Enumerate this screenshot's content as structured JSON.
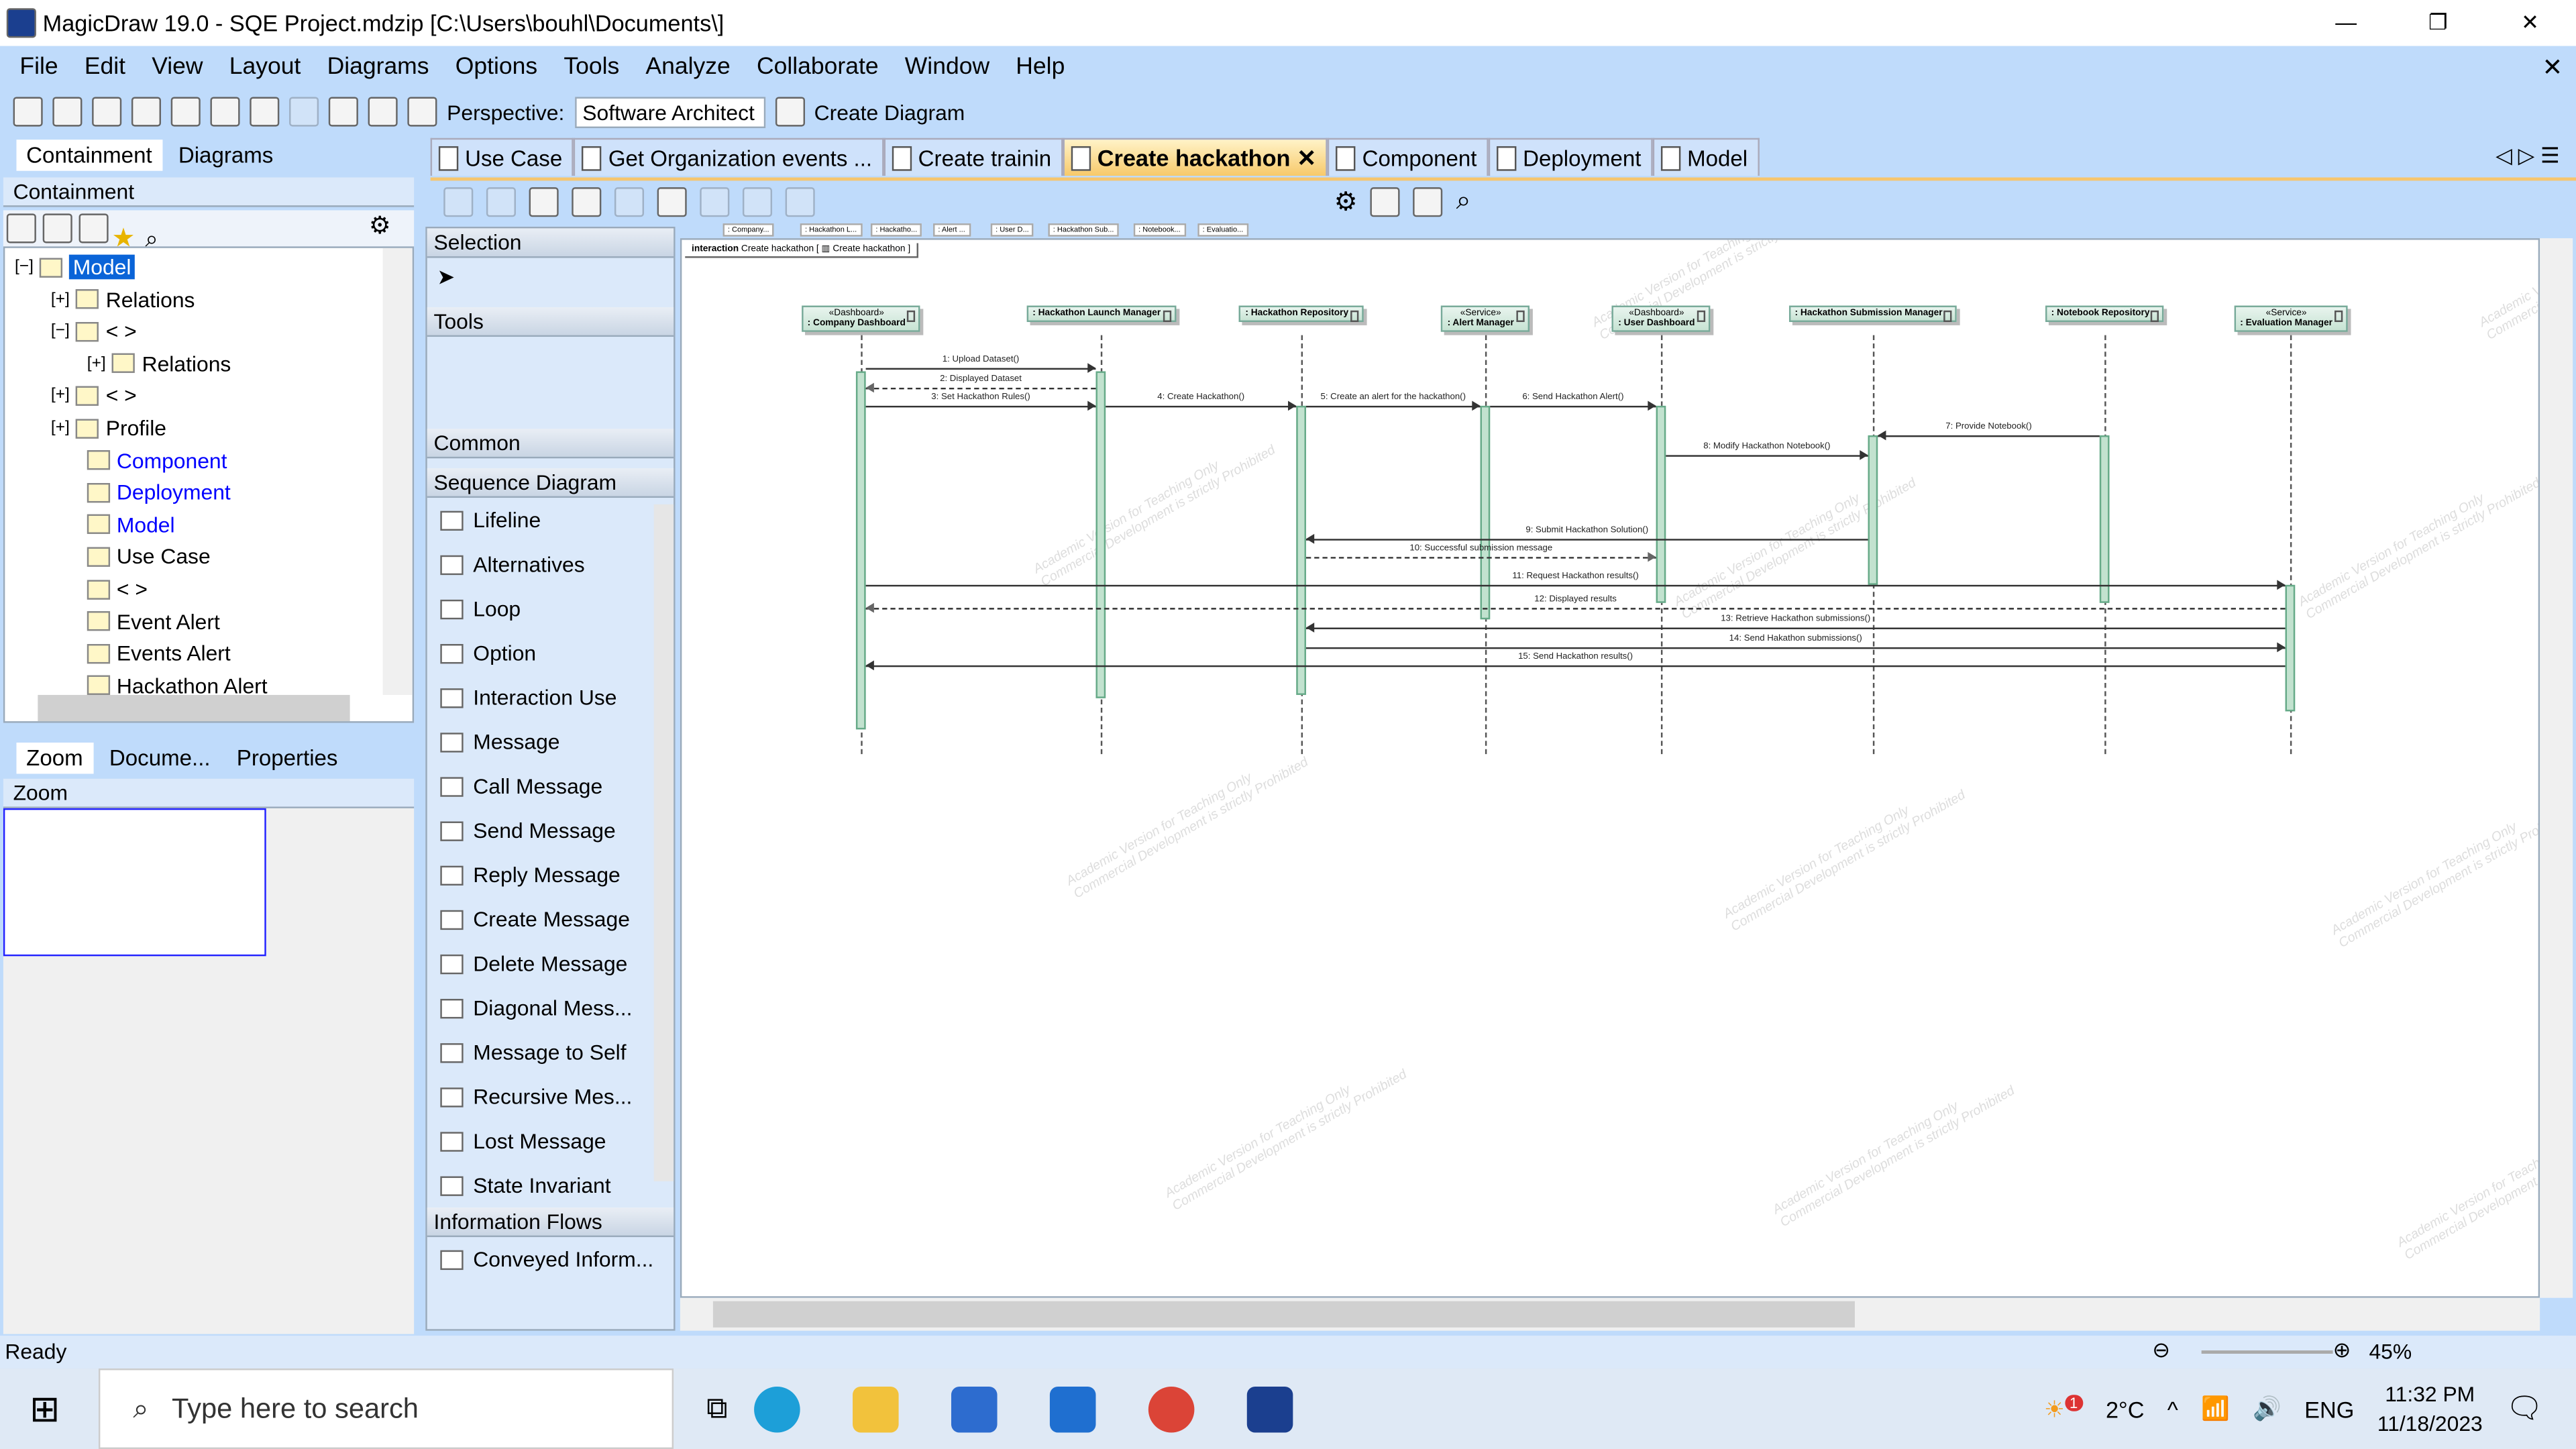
{
  "window": {
    "title": "MagicDraw 19.0 - SQE Project.mdzip [C:\\Users\\bouhl\\Documents\\]",
    "minimize": "—",
    "restore": "❐",
    "close": "✕"
  },
  "menu": [
    "File",
    "Edit",
    "View",
    "Layout",
    "Diagrams",
    "Options",
    "Tools",
    "Analyze",
    "Collaborate",
    "Window",
    "Help"
  ],
  "toolbar": {
    "perspective_label": "Perspective:",
    "perspective_value": "Software Architect",
    "create_diagram": "Create Diagram"
  },
  "left_panel": {
    "tabs": [
      "Containment",
      "Diagrams"
    ],
    "header": "Containment",
    "tree": [
      {
        "label": "Model",
        "level": 0,
        "expander": "−",
        "selected": true
      },
      {
        "label": "Relations",
        "level": 1,
        "expander": "+"
      },
      {
        "label": "< >",
        "level": 1,
        "expander": "−"
      },
      {
        "label": "Relations",
        "level": 2,
        "expander": "+"
      },
      {
        "label": "< >",
        "level": 1,
        "expander": "+"
      },
      {
        "label": "Profile",
        "level": 1,
        "expander": "+"
      },
      {
        "label": "Component",
        "level": 1,
        "link": true
      },
      {
        "label": "Deployment",
        "level": 1,
        "link": true
      },
      {
        "label": "Model",
        "level": 1,
        "link": true
      },
      {
        "label": "Use Case",
        "level": 1
      },
      {
        "label": "< >",
        "level": 1
      },
      {
        "label": "Event Alert",
        "level": 1
      },
      {
        "label": "Events Alert",
        "level": 1
      },
      {
        "label": "Hackathon Alert",
        "level": 1
      }
    ],
    "bottom_tabs": [
      "Zoom",
      "Docume...",
      "Properties"
    ],
    "zoom_header": "Zoom"
  },
  "palette": {
    "selection": "Selection",
    "tools": "Tools",
    "common": "Common",
    "sequence": "Sequence Diagram",
    "items": [
      "Lifeline",
      "Alternatives",
      "Loop",
      "Option",
      "Interaction Use",
      "Message",
      "Call Message",
      "Send Message",
      "Reply Message",
      "Create Message",
      "Delete Message",
      "Diagonal Mess...",
      "Message to Self",
      "Recursive Mes...",
      "Lost Message",
      "State Invariant"
    ],
    "information_flows": "Information Flows",
    "conveyed": "Conveyed Inform..."
  },
  "tabs": [
    {
      "label": "Use Case"
    },
    {
      "label": "Get Organization events ..."
    },
    {
      "label": "Create trainin"
    },
    {
      "label": "Create hackathon",
      "active": true,
      "close": "✕"
    },
    {
      "label": "Component"
    },
    {
      "label": "Deployment"
    },
    {
      "label": "Model"
    }
  ],
  "diagram": {
    "frame_keyword": "interaction",
    "frame_name": "Create hackathon",
    "frame_ref": "Create hackathon",
    "mini_headers": [
      ": Company...",
      ": Hackathon L...",
      ": Hackatho...",
      ": Alert ...",
      ": User D...",
      ": Hackathon Sub...",
      ": Notebook...",
      ": Evaluatio..."
    ],
    "lifelines": [
      {
        "stereotype": "«Dashboard»",
        "name": ": Company Dashboard"
      },
      {
        "stereotype": "",
        "name": ": Hackathon Launch Manager"
      },
      {
        "stereotype": "",
        "name": ": Hackathon Repository"
      },
      {
        "stereotype": "«Service»",
        "name": ": Alert Manager"
      },
      {
        "stereotype": "«Dashboard»",
        "name": ": User Dashboard"
      },
      {
        "stereotype": "",
        "name": ": Hackathon Submission Manager"
      },
      {
        "stereotype": "",
        "name": ": Notebook Repository"
      },
      {
        "stereotype": "«Service»",
        "name": ": Evaluation Manager"
      }
    ],
    "messages": [
      {
        "label": "1: Upload Dataset()",
        "from": 0,
        "to": 1,
        "kind": "call"
      },
      {
        "label": "2: Displayed Dataset",
        "from": 1,
        "to": 0,
        "kind": "reply"
      },
      {
        "label": "3: Set Hackathon Rules()",
        "from": 0,
        "to": 1,
        "kind": "call"
      },
      {
        "label": "4: Create Hackathon()",
        "from": 1,
        "to": 2,
        "kind": "call"
      },
      {
        "label": "5: Create an alert for the hackathon()",
        "from": 2,
        "to": 3,
        "kind": "call"
      },
      {
        "label": "6: Send Hackathon Alert()",
        "from": 3,
        "to": 4,
        "kind": "call"
      },
      {
        "label": "7: Provide Notebook()",
        "from": 6,
        "to": 5,
        "kind": "call"
      },
      {
        "label": "8: Modify Hackathon Notebook()",
        "from": 4,
        "to": 5,
        "kind": "call"
      },
      {
        "label": "9: Submit Hackathon Solution()",
        "from": 5,
        "to": 2,
        "kind": "call"
      },
      {
        "label": "10: Successful submission message",
        "from": 2,
        "to": 4,
        "kind": "reply"
      },
      {
        "label": "11: Request Hackathon results()",
        "from": 0,
        "to": 7,
        "kind": "call"
      },
      {
        "label": "12: Displayed results",
        "from": 7,
        "to": 0,
        "kind": "reply"
      },
      {
        "label": "13: Retrieve Hackathon submissions()",
        "from": 7,
        "to": 2,
        "kind": "call"
      },
      {
        "label": "14: Send Hakathon submissions()",
        "from": 2,
        "to": 7,
        "kind": "call"
      },
      {
        "label": "15: Send Hackathon results()",
        "from": 7,
        "to": 0,
        "kind": "call"
      }
    ],
    "watermark": "Academic Version for Teaching Only\nCommercial Development is strictly Prohibited",
    "activation_color": "#c2e2cf"
  },
  "status": {
    "text": "Ready",
    "zoom": "45%"
  },
  "taskbar": {
    "search_placeholder": "Type here to search",
    "weather": "2°C",
    "weather_badge": "1",
    "lang": "ENG",
    "time": "11:32 PM",
    "date": "11/18/2023"
  }
}
